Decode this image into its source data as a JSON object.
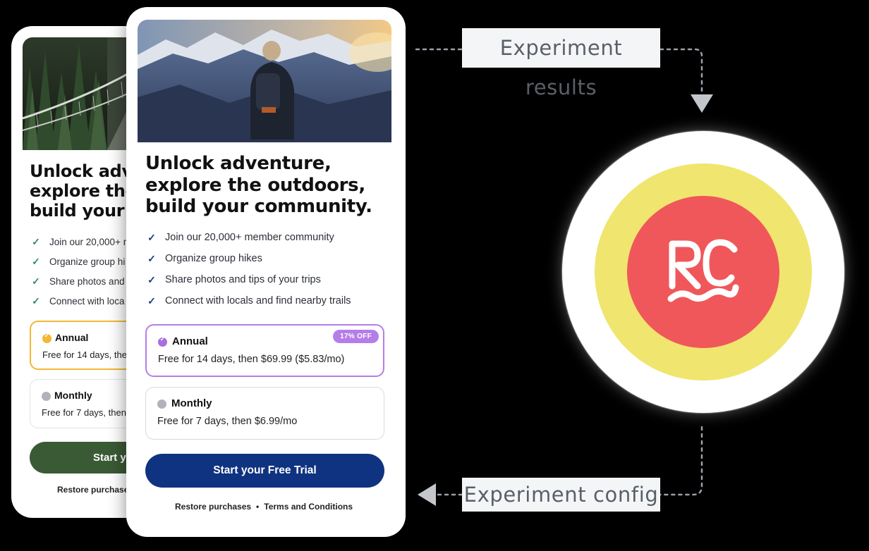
{
  "front_card": {
    "headline": "Unlock adventure,\nexplore the outdoors,\nbuild your community.",
    "features": [
      "Join our 20,000+ member community",
      "Organize group hikes",
      "Share photos and tips of your trips",
      "Connect with locals and find nearby trails"
    ],
    "plans": {
      "annual": {
        "name": "Annual",
        "desc": "Free for 14 days, then $69.99 ($5.83/mo)",
        "badge": "17% OFF"
      },
      "monthly": {
        "name": "Monthly",
        "desc": "Free for 7 days, then $6.99/mo"
      }
    },
    "cta_label": "Start your Free Trial",
    "footer": {
      "restore": "Restore purchases",
      "separator": "•",
      "terms": "Terms and Conditions"
    }
  },
  "back_card": {
    "headline": "Unlock adv\nexplore the\nbuild your c",
    "features": [
      "Join our 20,000+ m",
      "Organize group hi",
      "Share photos and",
      "Connect with loca"
    ],
    "plans": {
      "annual": {
        "name": "Annual",
        "desc": "Free for 14 days, the"
      },
      "monthly": {
        "name": "Monthly",
        "desc": "Free for 7 days, then"
      }
    },
    "cta_label": "Start y",
    "footer": {
      "restore": "Restore purchase"
    }
  },
  "flow": {
    "results_label": "Experiment results",
    "config_label": "Experiment config"
  },
  "logo": {
    "text": "RC",
    "ring_colors": [
      "#ffffff",
      "#f0e56e",
      "#f0575a"
    ]
  },
  "colors": {
    "front_accent": "#0f3380",
    "front_selected": "#b57de8",
    "back_accent": "#3a5a35",
    "back_selected": "#f2b733"
  }
}
